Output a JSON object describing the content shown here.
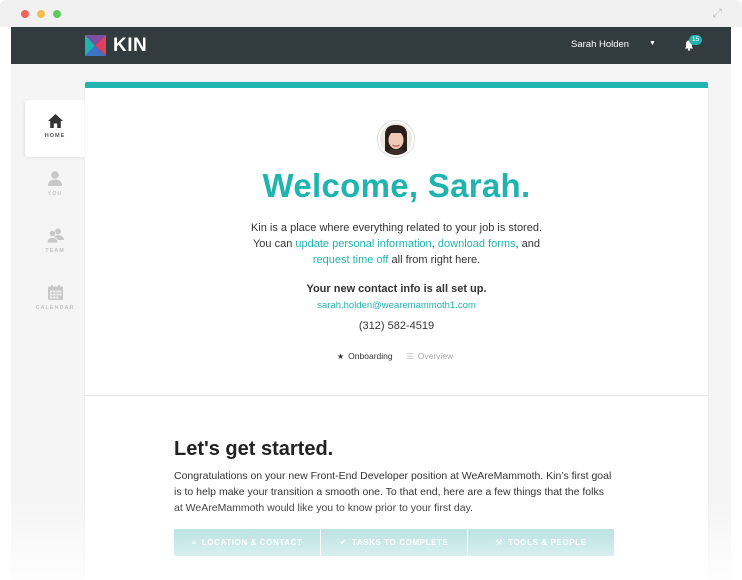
{
  "app": {
    "logo_text": "KIN",
    "brand_color": "#1fb4b0",
    "header_color": "#323c3e"
  },
  "header": {
    "user_name": "Sarah Holden",
    "notification_count": "15"
  },
  "sidebar": {
    "items": [
      {
        "label": "HOME",
        "icon": "home-icon",
        "active": true
      },
      {
        "label": "YOU",
        "icon": "person-icon",
        "active": false
      },
      {
        "label": "TEAM",
        "icon": "team-icon",
        "active": false
      },
      {
        "label": "CALENDAR",
        "icon": "calendar-icon",
        "active": false
      }
    ]
  },
  "welcome": {
    "heading": "Welcome, Sarah.",
    "intro_line1": "Kin is a place where everything related to your job is stored.",
    "intro_you_can": "You can ",
    "link_update": "update personal information",
    "intro_comma": ", ",
    "link_download": "download forms",
    "intro_and": ", and",
    "link_timeoff": "request time off",
    "intro_end": " all from right here."
  },
  "contact": {
    "title": "Your new contact info is all set up.",
    "email": "sarah.holden@wearemammoth1.com",
    "phone": "(312) 582-4519"
  },
  "subtabs": [
    {
      "label": "Onboarding",
      "icon": "star-icon",
      "active": true
    },
    {
      "label": "Overview",
      "icon": "list-icon",
      "active": false
    }
  ],
  "getting_started": {
    "title": "Let's get started.",
    "body": "Congratulations on your new Front-End Developer position at WeAreMammoth. Kin’s first goal is to help make your transition a smooth one. To that end, here are a few things that the folks at WeAreMammoth would like you to know prior to your first day."
  },
  "actions": [
    {
      "label": "LOCATION & CONTACT",
      "icon": "list-icon"
    },
    {
      "label": "TASKS TO COMPLETE",
      "icon": "check-icon"
    },
    {
      "label": "TOOLS & PEOPLE",
      "icon": "tools-icon"
    }
  ]
}
